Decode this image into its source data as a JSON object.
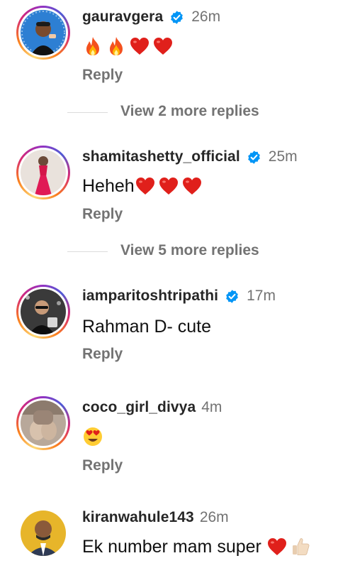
{
  "comments": [
    {
      "username": "gauravgera",
      "verified": true,
      "time": "26m",
      "text": "",
      "emojis": [
        "fire",
        "fire",
        "red-heart",
        "red-heart"
      ],
      "reply_label": "Reply",
      "story_ring": true
    },
    {
      "username": "shamitashetty_official",
      "verified": true,
      "time": "25m",
      "text": "Heheh",
      "emojis": [
        "red-heart",
        "red-heart",
        "red-heart"
      ],
      "reply_label": "Reply",
      "story_ring": true
    },
    {
      "username": "iamparitoshtripathi",
      "verified": true,
      "time": "17m",
      "text": "Rahman D- cute",
      "emojis": [],
      "reply_label": "Reply",
      "story_ring": true
    },
    {
      "username": "coco_girl_divya",
      "verified": false,
      "time": "4m",
      "text": "",
      "emojis": [
        "heart-eyes"
      ],
      "reply_label": "Reply",
      "story_ring": true
    },
    {
      "username": "kiranwahule143",
      "verified": false,
      "time": "26m",
      "text": "Ek number mam super ",
      "emojis": [
        "red-heart",
        "thumbs-up"
      ],
      "reply_label": "",
      "story_ring": false
    }
  ],
  "view_more": [
    {
      "label": "View 2 more replies"
    },
    {
      "label": "View 5 more replies"
    }
  ],
  "colors": {
    "verified_blue": "#0095f6",
    "secondary_text": "#737373",
    "primary_text": "#262626"
  }
}
